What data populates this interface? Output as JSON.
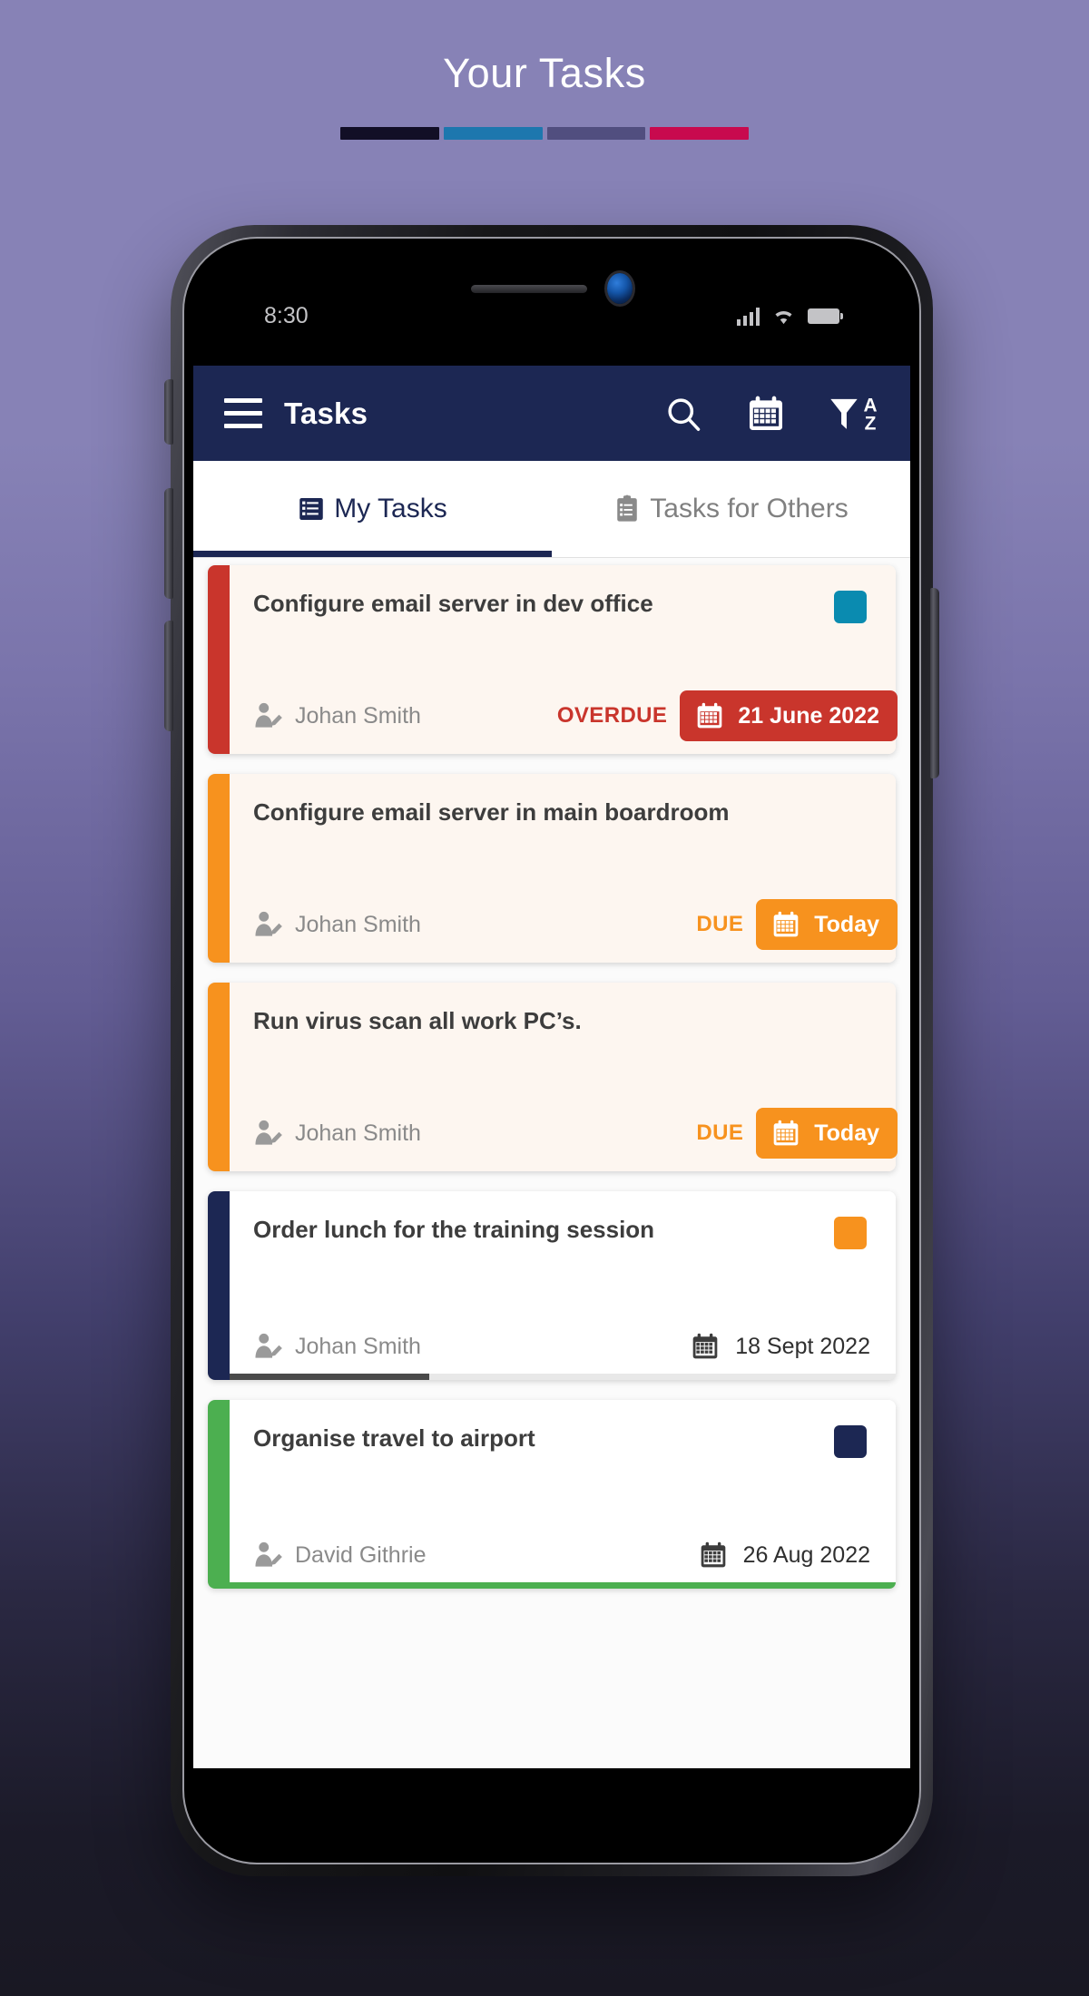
{
  "poster": {
    "title": "Your Tasks",
    "color_bar": [
      "#120f26",
      "#1d77ae",
      "#514e7f",
      "#c80a4e"
    ]
  },
  "phone": {
    "status_bar": {
      "time": "8:30",
      "icons": [
        "signal-icon",
        "wifi-icon",
        "battery-icon"
      ]
    }
  },
  "app": {
    "app_bar": {
      "menu_icon": "hamburger-menu-icon",
      "title": "Tasks",
      "actions": [
        "search-icon",
        "calendar-icon",
        "filter-sort-icon"
      ],
      "background": "#1c2753"
    },
    "tabs": [
      {
        "label": "My Tasks",
        "icon": "list-icon",
        "active": true
      },
      {
        "label": "Tasks for Others",
        "icon": "clipboard-icon",
        "active": false
      }
    ],
    "tasks": [
      {
        "title": "Configure email server in dev office",
        "assignee": "Johan Smith",
        "stripe_color": "#c9352c",
        "card_background": "#fdf6f0",
        "chip_color": "#0a8bb0",
        "due_label": "OVERDUE",
        "due_label_color": "#c9352c",
        "date": "21 June 2022",
        "date_style": "pill",
        "date_pill_color": "#c9352c",
        "progress_percent": 0,
        "progress_color": "#c9352c",
        "show_progress": false
      },
      {
        "title": "Configure email server in main boardroom",
        "assignee": "Johan Smith",
        "stripe_color": "#f7921e",
        "card_background": "#fdf6f0",
        "chip_color": null,
        "due_label": "DUE",
        "due_label_color": "#f7921e",
        "date": "Today",
        "date_style": "pill",
        "date_pill_color": "#f7921e",
        "progress_percent": 0,
        "progress_color": "#f7921e",
        "show_progress": false
      },
      {
        "title": "Run virus scan all work PC’s.",
        "assignee": "Johan Smith",
        "stripe_color": "#f7921e",
        "card_background": "#fdf6f0",
        "chip_color": null,
        "due_label": "DUE",
        "due_label_color": "#f7921e",
        "date": "Today",
        "date_style": "pill",
        "date_pill_color": "#f7921e",
        "progress_percent": 0,
        "progress_color": "#f7921e",
        "show_progress": false
      },
      {
        "title": "Order lunch for the training session",
        "assignee": "Johan Smith",
        "stripe_color": "#1c2753",
        "card_background": "#ffffff",
        "chip_color": "#f7921e",
        "due_label": "",
        "due_label_color": "",
        "date": "18 Sept 2022",
        "date_style": "plain",
        "date_pill_color": "",
        "progress_percent": 30,
        "progress_color": "#4a4a4a",
        "show_progress": true
      },
      {
        "title": "Organise travel to airport",
        "assignee": "David Githrie",
        "stripe_color": "#4caf50",
        "card_background": "#ffffff",
        "chip_color": "#1c2753",
        "due_label": "",
        "due_label_color": "",
        "date": "26 Aug 2022",
        "date_style": "plain",
        "date_pill_color": "",
        "progress_percent": 100,
        "progress_color": "#4caf50",
        "show_progress": true
      }
    ]
  }
}
